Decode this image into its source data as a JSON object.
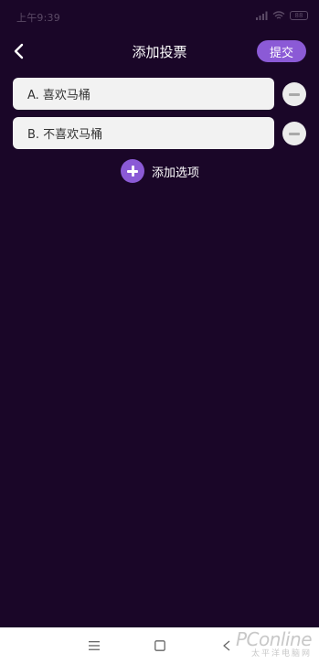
{
  "status_bar": {
    "time": "上午9:39",
    "battery": "88"
  },
  "nav": {
    "title": "添加投票",
    "submit_label": "提交"
  },
  "options": [
    {
      "label": "A.  喜欢马桶"
    },
    {
      "label": "B.  不喜欢马桶"
    }
  ],
  "add_option": {
    "label": "添加选项"
  },
  "watermark": {
    "main": "PConline",
    "sub": "太平洋电脑网"
  },
  "colors": {
    "background": "#1a0628",
    "accent": "#8b5ad6",
    "field": "#f2f2f2"
  }
}
